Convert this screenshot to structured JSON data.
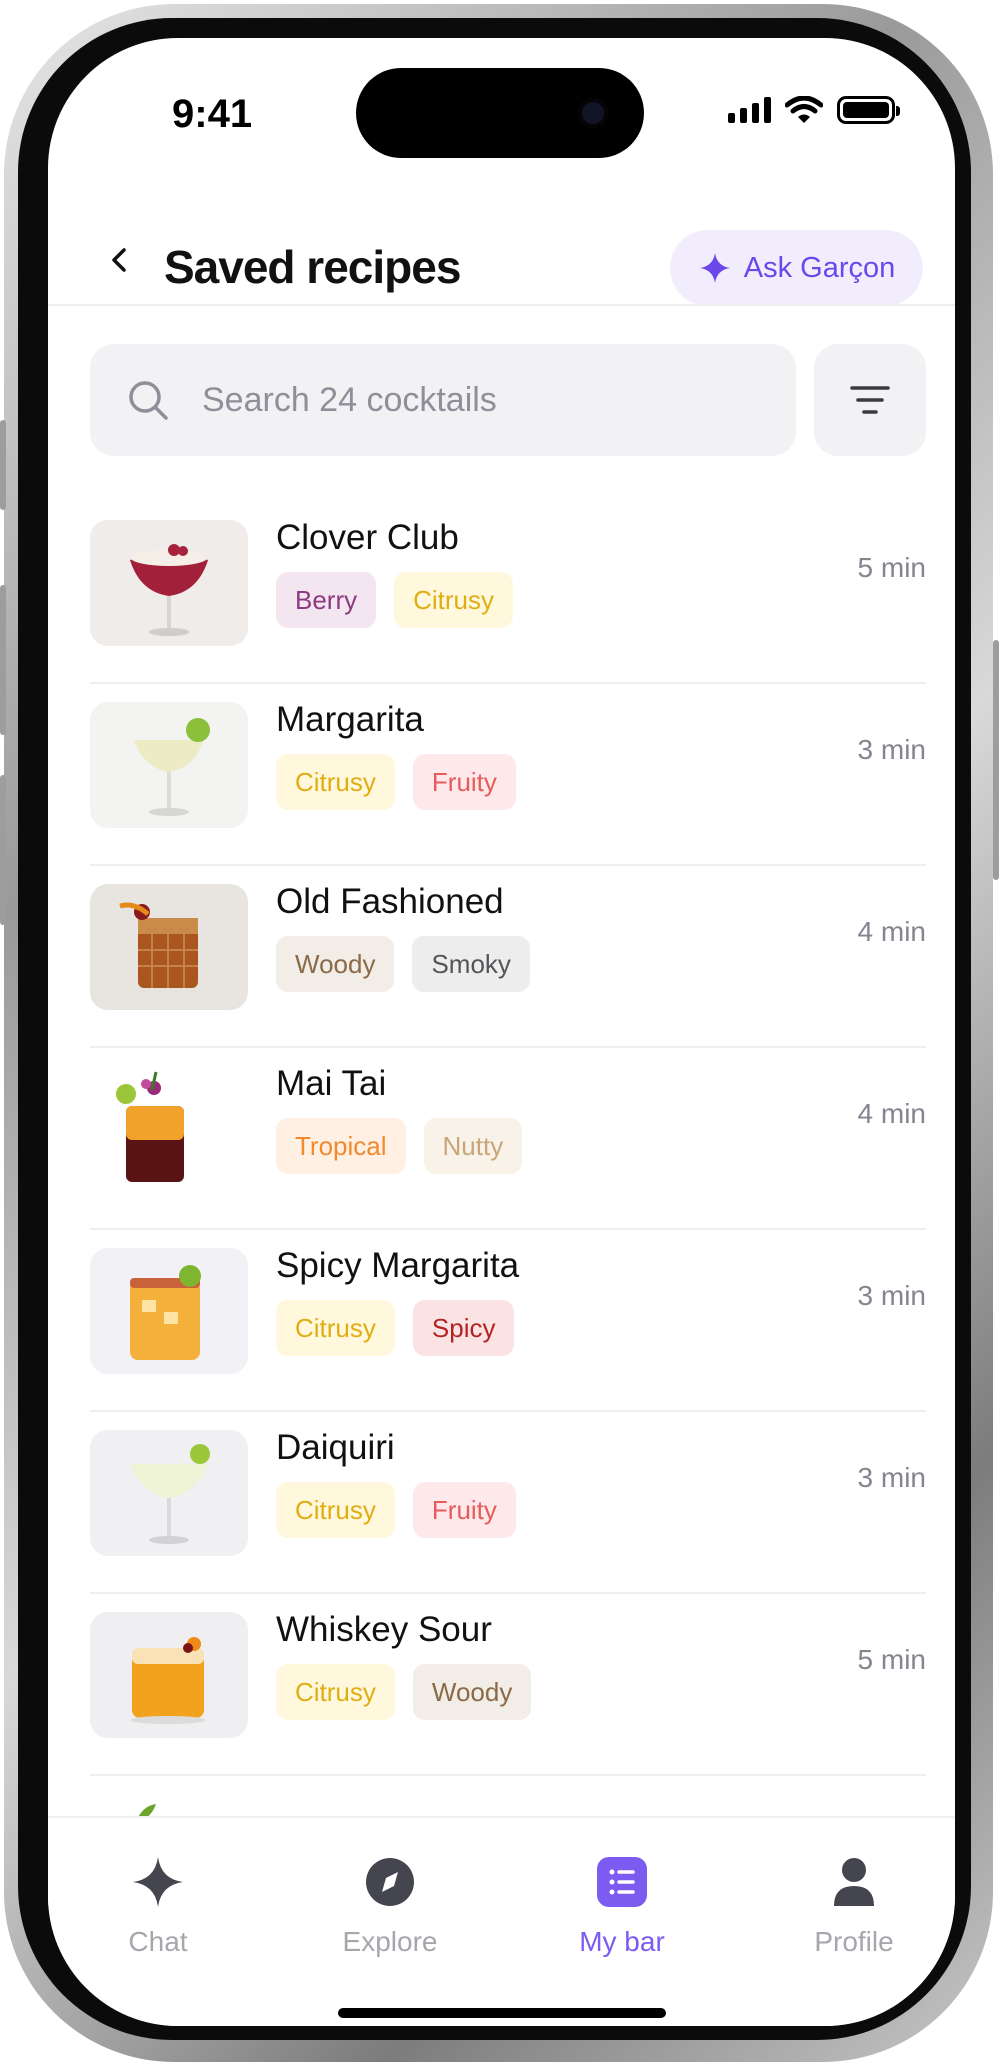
{
  "status_bar": {
    "time": "9:41"
  },
  "header": {
    "title": "Saved recipes",
    "ask_button_label": "Ask Garçon"
  },
  "search": {
    "placeholder": "Search 24 cocktails",
    "value": ""
  },
  "recipes": [
    {
      "name": "Clover Club",
      "time": "5 min",
      "tags": [
        "Berry",
        "Citrusy"
      ],
      "image": "clover-club-image"
    },
    {
      "name": "Margarita",
      "time": "3 min",
      "tags": [
        "Citrusy",
        "Fruity"
      ],
      "image": "margarita-image"
    },
    {
      "name": "Old Fashioned",
      "time": "4 min",
      "tags": [
        "Woody",
        "Smoky"
      ],
      "image": "old-fashioned-image"
    },
    {
      "name": "Mai Tai",
      "time": "4 min",
      "tags": [
        "Tropical",
        "Nutty"
      ],
      "image": "mai-tai-image"
    },
    {
      "name": "Spicy Margarita",
      "time": "3 min",
      "tags": [
        "Citrusy",
        "Spicy"
      ],
      "image": "spicy-margarita-image"
    },
    {
      "name": "Daiquiri",
      "time": "3 min",
      "tags": [
        "Citrusy",
        "Fruity"
      ],
      "image": "daiquiri-image"
    },
    {
      "name": "Whiskey Sour",
      "time": "5 min",
      "tags": [
        "Citrusy",
        "Woody"
      ],
      "image": "whiskey-sour-image"
    }
  ],
  "tag_colors": {
    "Berry": {
      "bg": "#f3e6f1",
      "fg": "#8d3a7e"
    },
    "Citrusy": {
      "bg": "#fff8dc",
      "fg": "#e0ae12"
    },
    "Fruity": {
      "bg": "#fde9e9",
      "fg": "#ea5a5a"
    },
    "Woody": {
      "bg": "#f2ede7",
      "fg": "#8a6a48"
    },
    "Smoky": {
      "bg": "#ededee",
      "fg": "#555559"
    },
    "Tropical": {
      "bg": "#fff0e3",
      "fg": "#f08a2c"
    },
    "Nutty": {
      "bg": "#f8f2e8",
      "fg": "#c9a677"
    },
    "Spicy": {
      "bg": "#fbe3e3",
      "fg": "#b42323"
    }
  },
  "tabs": [
    {
      "label": "Chat",
      "icon": "sparkle-icon",
      "active": false
    },
    {
      "label": "Explore",
      "icon": "compass-icon",
      "active": false
    },
    {
      "label": "My bar",
      "icon": "list-icon",
      "active": true
    },
    {
      "label": "Profile",
      "icon": "user-icon",
      "active": false
    }
  ],
  "colors": {
    "accent": "#7c5bf0",
    "ask_bg": "#f1edfd",
    "ask_fg": "#6c47ea"
  }
}
